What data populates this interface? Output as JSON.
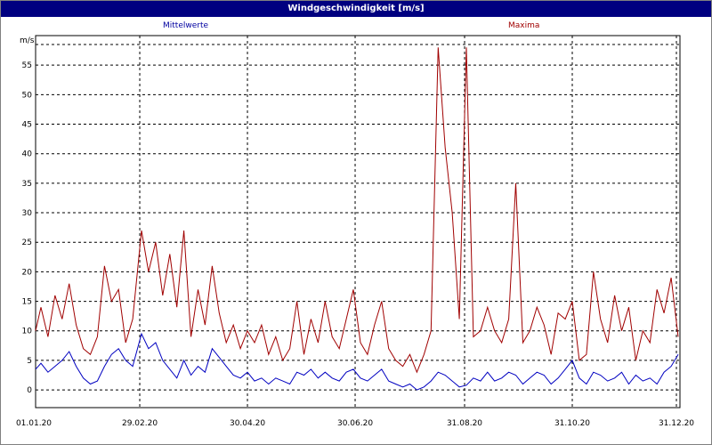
{
  "window": {
    "title": "Windgeschwindigkeit [m/s]"
  },
  "chart_data": {
    "type": "line",
    "title": "Windgeschwindigkeit [m/s]",
    "ylabel": "m/s",
    "ylim": [
      -3,
      60
    ],
    "yticks": [
      0,
      5,
      10,
      15,
      20,
      25,
      30,
      35,
      40,
      45,
      50,
      55
    ],
    "xlim": [
      "2020-01-01",
      "2020-12-31"
    ],
    "xtick_labels": [
      "01.01.20",
      "29.02.20",
      "30.04.20",
      "30.06.20",
      "31.08.20",
      "31.10.20",
      "31.12.20"
    ],
    "grid": true,
    "legend_position": "top",
    "series": [
      {
        "name": "Mittelwerte",
        "color": "#0000c0",
        "x": [
          "2020-01-01",
          "2020-01-04",
          "2020-01-08",
          "2020-01-12",
          "2020-01-16",
          "2020-01-20",
          "2020-01-24",
          "2020-01-28",
          "2020-02-01",
          "2020-02-05",
          "2020-02-09",
          "2020-02-13",
          "2020-02-17",
          "2020-02-21",
          "2020-02-25",
          "2020-03-01",
          "2020-03-05",
          "2020-03-09",
          "2020-03-13",
          "2020-03-17",
          "2020-03-21",
          "2020-03-25",
          "2020-03-29",
          "2020-04-02",
          "2020-04-06",
          "2020-04-10",
          "2020-04-14",
          "2020-04-18",
          "2020-04-22",
          "2020-04-26",
          "2020-04-30",
          "2020-05-04",
          "2020-05-08",
          "2020-05-12",
          "2020-05-16",
          "2020-05-20",
          "2020-05-24",
          "2020-05-28",
          "2020-06-01",
          "2020-06-05",
          "2020-06-09",
          "2020-06-13",
          "2020-06-17",
          "2020-06-21",
          "2020-06-25",
          "2020-06-29",
          "2020-07-03",
          "2020-07-07",
          "2020-07-11",
          "2020-07-15",
          "2020-07-19",
          "2020-07-23",
          "2020-07-27",
          "2020-07-31",
          "2020-08-04",
          "2020-08-08",
          "2020-08-12",
          "2020-08-16",
          "2020-08-20",
          "2020-08-24",
          "2020-08-28",
          "2020-09-01",
          "2020-09-05",
          "2020-09-09",
          "2020-09-13",
          "2020-09-17",
          "2020-09-21",
          "2020-09-25",
          "2020-09-29",
          "2020-10-03",
          "2020-10-07",
          "2020-10-11",
          "2020-10-15",
          "2020-10-19",
          "2020-10-23",
          "2020-10-27",
          "2020-10-31",
          "2020-11-04",
          "2020-11-08",
          "2020-11-12",
          "2020-11-16",
          "2020-11-20",
          "2020-11-24",
          "2020-11-28",
          "2020-12-02",
          "2020-12-06",
          "2020-12-10",
          "2020-12-14",
          "2020-12-18",
          "2020-12-22",
          "2020-12-26",
          "2020-12-30"
        ],
        "y": [
          3.5,
          4.5,
          3,
          4,
          5,
          6.5,
          4,
          2,
          1,
          1.5,
          4,
          6,
          7,
          5,
          4,
          9.5,
          7,
          8,
          5,
          3.5,
          2,
          5,
          2.5,
          4,
          3,
          7,
          5.5,
          4,
          2.5,
          2,
          3,
          1.5,
          2,
          1,
          2,
          1.5,
          1,
          3,
          2.5,
          3.5,
          2,
          3,
          2,
          1.5,
          3,
          3.5,
          2,
          1.5,
          2.5,
          3.5,
          1.5,
          1,
          0.5,
          1,
          0,
          0.5,
          1.5,
          3,
          2.5,
          1.5,
          0.5,
          0.8,
          2,
          1.5,
          3,
          1.5,
          2,
          3,
          2.5,
          1,
          2,
          3,
          2.5,
          1,
          2,
          3.5,
          5,
          2,
          1,
          3,
          2.5,
          1.5,
          2,
          3,
          1,
          2.5,
          1.5,
          2,
          1,
          3,
          4,
          6
        ]
      },
      {
        "name": "Maxima",
        "color": "#a00000",
        "x": [
          "2020-01-01",
          "2020-01-04",
          "2020-01-08",
          "2020-01-12",
          "2020-01-16",
          "2020-01-20",
          "2020-01-24",
          "2020-01-28",
          "2020-02-01",
          "2020-02-05",
          "2020-02-09",
          "2020-02-13",
          "2020-02-17",
          "2020-02-21",
          "2020-02-25",
          "2020-03-01",
          "2020-03-05",
          "2020-03-09",
          "2020-03-13",
          "2020-03-17",
          "2020-03-21",
          "2020-03-25",
          "2020-03-29",
          "2020-04-02",
          "2020-04-06",
          "2020-04-10",
          "2020-04-14",
          "2020-04-18",
          "2020-04-22",
          "2020-04-26",
          "2020-04-30",
          "2020-05-04",
          "2020-05-08",
          "2020-05-12",
          "2020-05-16",
          "2020-05-20",
          "2020-05-24",
          "2020-05-28",
          "2020-06-01",
          "2020-06-05",
          "2020-06-09",
          "2020-06-13",
          "2020-06-17",
          "2020-06-21",
          "2020-06-25",
          "2020-06-29",
          "2020-07-03",
          "2020-07-07",
          "2020-07-11",
          "2020-07-15",
          "2020-07-19",
          "2020-07-23",
          "2020-07-27",
          "2020-07-31",
          "2020-08-04",
          "2020-08-08",
          "2020-08-12",
          "2020-08-16",
          "2020-08-20",
          "2020-08-24",
          "2020-08-28",
          "2020-09-01",
          "2020-09-05",
          "2020-09-09",
          "2020-09-13",
          "2020-09-17",
          "2020-09-21",
          "2020-09-25",
          "2020-09-29",
          "2020-10-03",
          "2020-10-07",
          "2020-10-11",
          "2020-10-15",
          "2020-10-19",
          "2020-10-23",
          "2020-10-27",
          "2020-10-31",
          "2020-11-04",
          "2020-11-08",
          "2020-11-12",
          "2020-11-16",
          "2020-11-20",
          "2020-11-24",
          "2020-11-28",
          "2020-12-02",
          "2020-12-06",
          "2020-12-10",
          "2020-12-14",
          "2020-12-18",
          "2020-12-22",
          "2020-12-26",
          "2020-12-30"
        ],
        "y": [
          10,
          14,
          9,
          16,
          12,
          18,
          11,
          7,
          6,
          9,
          21,
          15,
          17,
          8,
          12,
          27,
          20,
          25,
          16,
          23,
          14,
          27,
          9,
          17,
          11,
          21,
          13,
          8,
          11,
          7,
          10,
          8,
          11,
          6,
          9,
          5,
          7,
          15,
          6,
          12,
          8,
          15,
          9,
          7,
          12,
          17,
          8,
          6,
          11,
          15,
          7,
          5,
          4,
          6,
          3,
          6,
          10,
          58,
          41,
          30,
          12,
          58,
          9,
          10,
          14,
          10,
          8,
          12,
          35,
          8,
          10,
          14,
          11,
          6,
          13,
          12,
          15,
          5,
          6,
          20,
          12,
          8,
          16,
          10,
          14,
          5,
          10,
          8,
          17,
          13,
          19,
          9
        ]
      }
    ]
  }
}
